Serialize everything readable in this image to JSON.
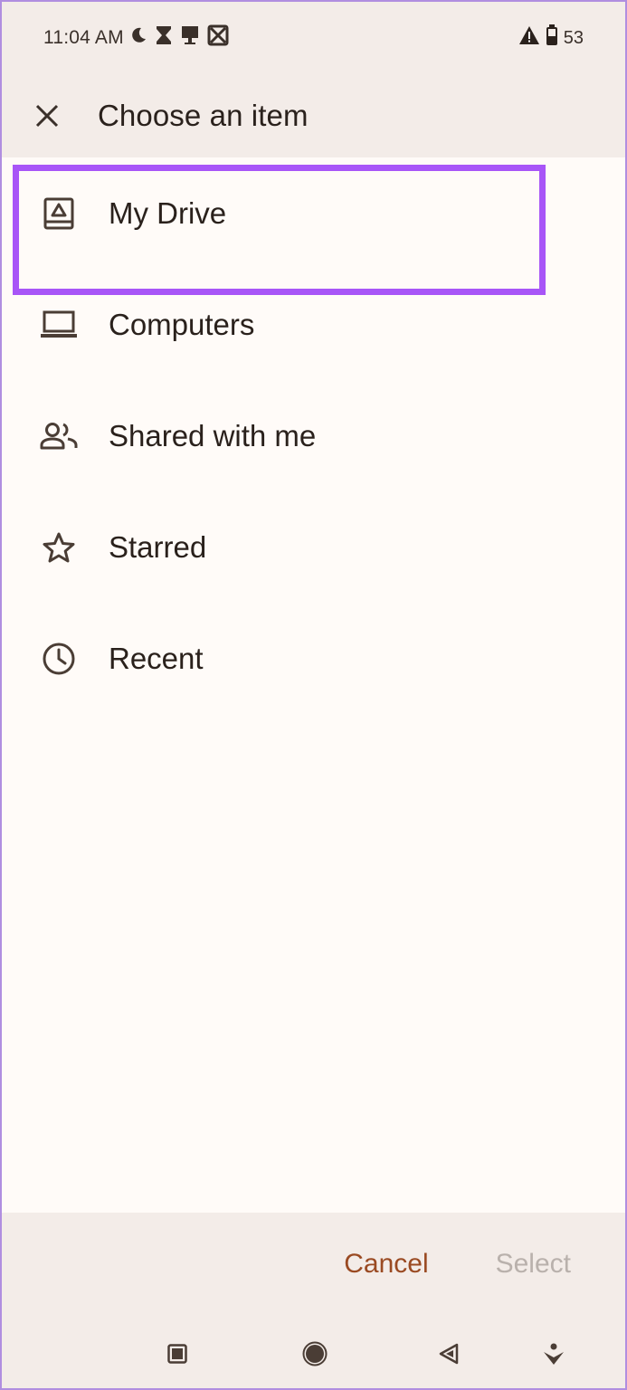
{
  "status_bar": {
    "time": "11:04 AM",
    "left_icons": [
      "moon-icon",
      "hourglass-icon",
      "download-icon",
      "no-sim-icon"
    ],
    "right_icons": [
      "alert-icon",
      "battery-icon"
    ],
    "battery_percent": "53"
  },
  "app_bar": {
    "close_icon": "close-icon",
    "title": "Choose an item"
  },
  "list": {
    "items": [
      {
        "label": "My Drive",
        "icon": "drive-icon",
        "highlighted": true
      },
      {
        "label": "Computers",
        "icon": "laptop-icon"
      },
      {
        "label": "Shared with me",
        "icon": "people-icon"
      },
      {
        "label": "Starred",
        "icon": "star-icon"
      },
      {
        "label": "Recent",
        "icon": "clock-icon"
      }
    ]
  },
  "actions": {
    "cancel_label": "Cancel",
    "select_label": "Select"
  },
  "colors": {
    "highlight": "#a855f7",
    "cancel_text": "#9a4a22",
    "disabled_text": "#b9b1ac",
    "surface": "#f3ece8"
  },
  "nav_bar": {
    "icons": [
      "recents-icon",
      "home-icon",
      "back-icon",
      "accessibility-icon"
    ]
  }
}
